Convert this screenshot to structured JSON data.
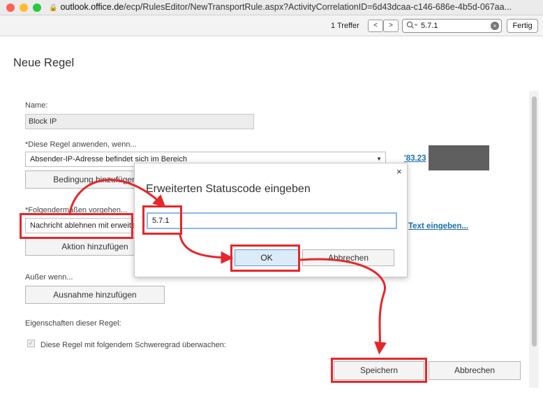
{
  "browser": {
    "url_host": "outlook.office.de",
    "url_path": "/ecp/RulesEditor/NewTransportRule.aspx?ActivityCorrelationID=6d43dcaa-c146-686e-4b5d-067aa...",
    "find": {
      "count": "1 Treffer",
      "prev": "<",
      "next": ">",
      "query": "5.7.1",
      "done": "Fertig"
    }
  },
  "page": {
    "title": "Neue Regel",
    "name_label": "Name:",
    "name_value": "Block IP",
    "apply_label": "*Diese Regel anwenden, wenn...",
    "condition_select": "Absender-IP-Adresse befindet sich im Bereich",
    "condition_link": "'83.23",
    "add_condition": "Bedingung hinzufügen",
    "do_label": "*Folgendermaßen vorgehen...",
    "action_select": "Nachricht ablehnen mit erweitertem Statuscode",
    "action_link": "Text eingeben...",
    "add_action": "Aktion hinzufügen",
    "except_label": "Außer wenn...",
    "add_exception": "Ausnahme hinzufügen",
    "props_label": "Eigenschaften dieser Regel:",
    "audit_label": "Diese Regel mit folgendem Schweregrad überwachen:",
    "save": "Speichern",
    "cancel": "Abbrechen"
  },
  "dialog": {
    "title": "Erweiterten Statuscode eingeben",
    "value": "5.7.1",
    "ok": "OK",
    "cancel": "Abbrechen",
    "close": "×"
  },
  "colors": {
    "annotation": "#e5272b",
    "link": "#1a6fa8",
    "ok_button": "#dcebf8"
  }
}
